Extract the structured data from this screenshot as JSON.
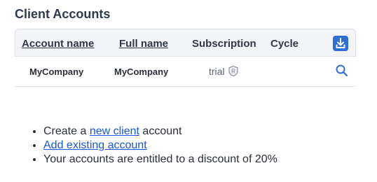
{
  "title": "Client Accounts",
  "table": {
    "headers": {
      "account_name": "Account name",
      "full_name": "Full name",
      "subscription": "Subscription",
      "cycle": "Cycle"
    },
    "download_icon": "download-icon",
    "rows": [
      {
        "account_name": "MyCompany",
        "full_name": "MyCompany",
        "subscription": "trial",
        "subscription_badge": "R",
        "cycle": ""
      }
    ]
  },
  "notes": {
    "item1_prefix": "Create a ",
    "item1_link": "new client",
    "item1_suffix": " account",
    "item2_link": "Add existing account",
    "item3": "Your accounts are entitled to a discount of 20%"
  },
  "colors": {
    "accent": "#2f6fd6",
    "link": "#1a56d6",
    "header_bg": "#f2f4f7"
  }
}
